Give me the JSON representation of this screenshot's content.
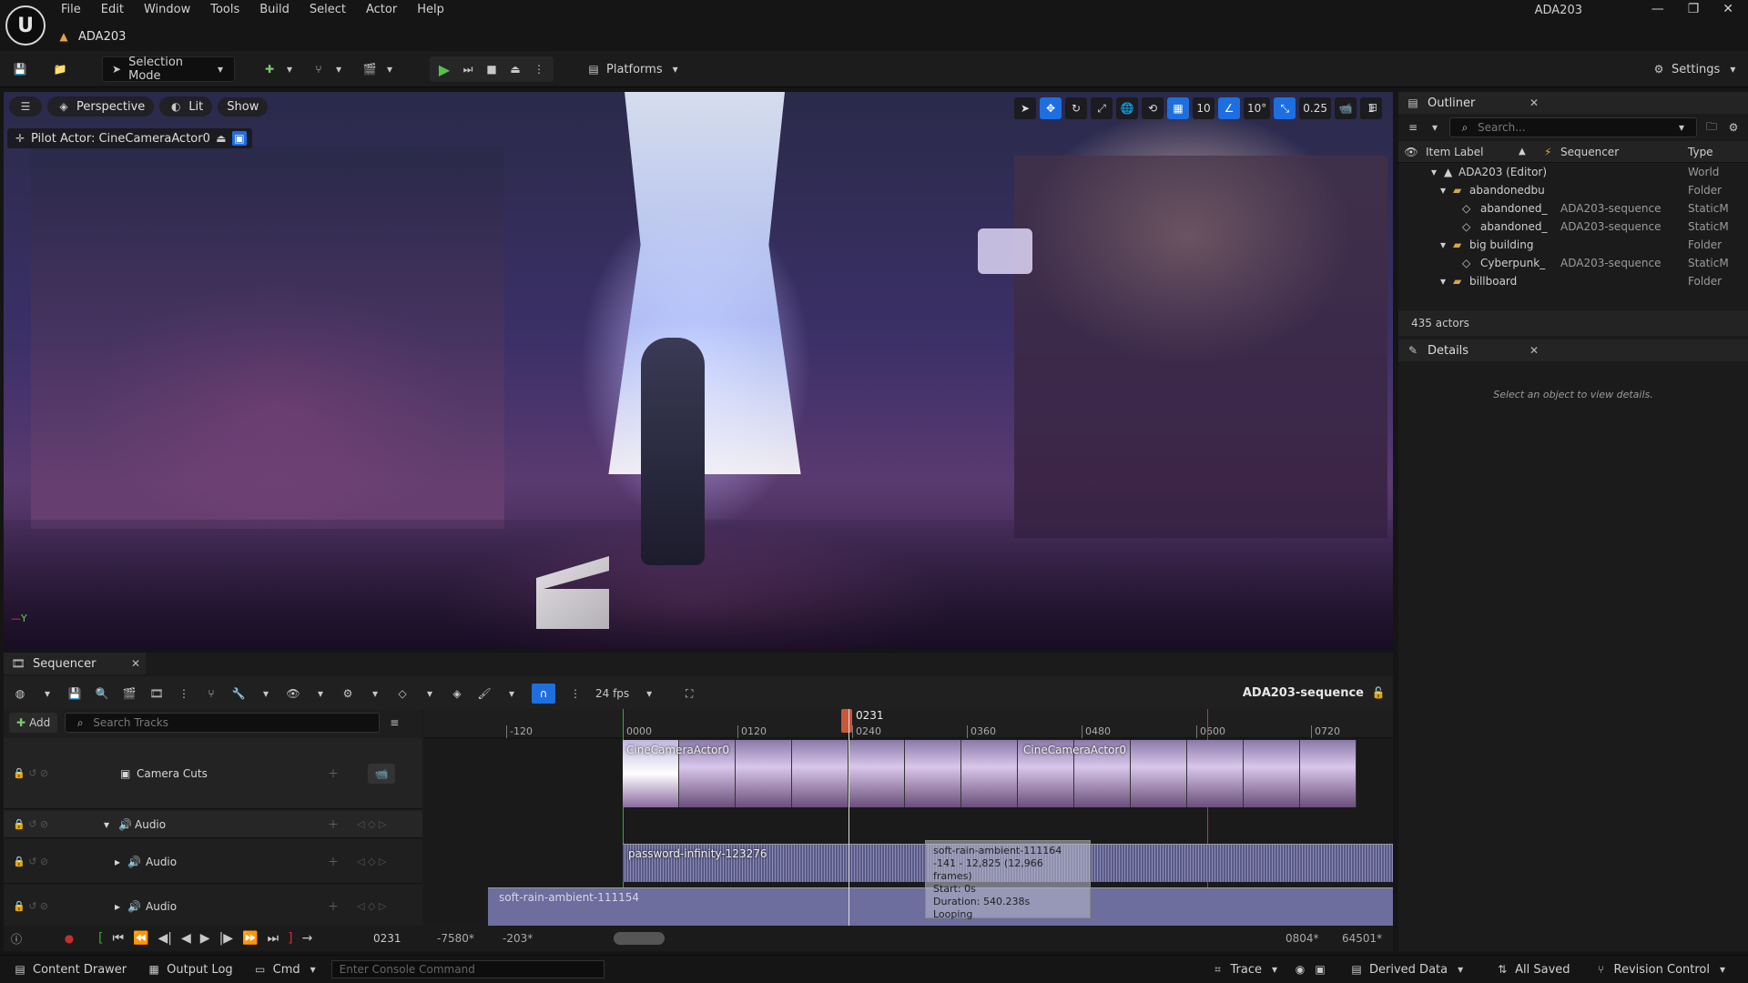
{
  "app": {
    "logo": "U",
    "window_title": "ADA203",
    "project_tab": "ADA203"
  },
  "menu": [
    "File",
    "Edit",
    "Window",
    "Tools",
    "Build",
    "Select",
    "Actor",
    "Help"
  ],
  "toolbar": {
    "selection_mode": "Selection Mode",
    "platforms": "Platforms",
    "settings": "Settings"
  },
  "viewport": {
    "perspective": "Perspective",
    "lit": "Lit",
    "show": "Show",
    "pilot": "Pilot Actor: CineCameraActor0",
    "grid_size": "10",
    "rot_snap": "10°",
    "scale_snap": "0.25",
    "camera_speed": "1"
  },
  "outliner": {
    "tab": "Outliner",
    "search_placeholder": "Search...",
    "col_label": "Item Label",
    "col_seq": "Sequencer",
    "col_type": "Type",
    "rows": [
      {
        "label": "ADA203 (Editor)",
        "seq": "",
        "type": "World"
      },
      {
        "label": "abandonedbu",
        "seq": "",
        "type": "Folder"
      },
      {
        "label": "abandoned_",
        "seq": "ADA203-sequence",
        "type": "StaticM"
      },
      {
        "label": "abandoned_",
        "seq": "ADA203-sequence",
        "type": "StaticM"
      },
      {
        "label": "big building",
        "seq": "",
        "type": "Folder"
      },
      {
        "label": "Cyberpunk_",
        "seq": "ADA203-sequence",
        "type": "StaticM"
      },
      {
        "label": "billboard",
        "seq": "",
        "type": "Folder"
      }
    ],
    "count": "435 actors"
  },
  "details": {
    "tab": "Details",
    "empty": "Select an object to view details."
  },
  "sequencer": {
    "tab": "Sequencer",
    "fps": "24 fps",
    "sequence_name": "ADA203-sequence",
    "add": "Add",
    "search_placeholder": "Search Tracks",
    "current_frame": "0231",
    "tracks": {
      "camera_cuts": "Camera Cuts",
      "audio_group": "Audio",
      "audio_1": "Audio",
      "audio_2": "Audio"
    },
    "ticks": [
      "-120",
      "0000",
      "0120",
      "0240",
      "0360",
      "0480",
      "0600",
      "0720"
    ],
    "clip_cam_1": "CineCameraActor0",
    "clip_cam_2": "CineCameraActor0",
    "clip_audio_1": "password-infinity-123276",
    "clip_audio_2": "soft-rain-ambient-111154",
    "tooltip": {
      "name": "soft-rain-ambient-111164",
      "range": "-141 - 12,825 (12,966 frames)",
      "start": "Start: 0s",
      "duration": "Duration: 540.238s",
      "looping": "Looping"
    },
    "footer": {
      "frame": "0231",
      "left1": "-7580*",
      "left2": "-203*",
      "right1": "0804*",
      "right2": "64501*"
    }
  },
  "bottom": {
    "content_drawer": "Content Drawer",
    "output_log": "Output Log",
    "cmd": "Cmd",
    "console_placeholder": "Enter Console Command",
    "trace": "Trace",
    "derived_data": "Derived Data",
    "all_saved": "All Saved",
    "revision_control": "Revision Control"
  }
}
